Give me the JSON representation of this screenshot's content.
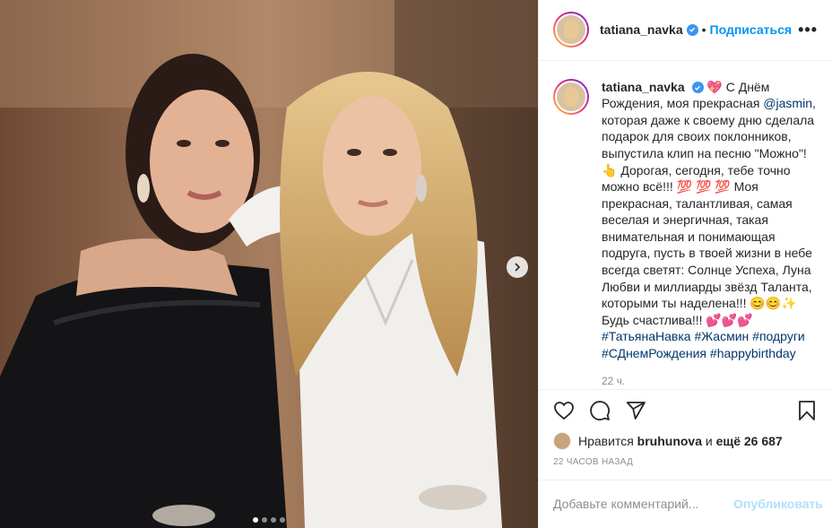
{
  "header": {
    "username": "tatiana_navka",
    "separator": "•",
    "follow_label": "Подписаться",
    "more_label": "•••"
  },
  "caption": {
    "username": "tatiana_navka",
    "emoji_heart": "💖",
    "t1": "С Днём Рождения, моя прекрасная ",
    "mention": "@jasmin",
    "t2": ", которая даже к своему дню сделала подарок для своих поклонников, выпустила клип на песню \"Можно\"! ",
    "emoji_point": "👆",
    "t3": " Дорогая, сегодня, тебе точно можно всё!!! ",
    "emoji_100": "💯 💯 💯",
    "t4": " Моя прекрасная, талантливая, самая веселая и энергичная, такая внимательная и понимающая подруга, пусть в твоей жизни в небе всегда светят: Солнце Успеха, Луна Любви и миллиарды звёзд Таланта, которыми ты наделена!!! ",
    "emoji_smiles": "😊😊✨",
    "t5": " Будь счастлива!!! ",
    "emoji_hearts": "💕💕💕",
    "tags": [
      "#ТатьянаНавка",
      "#Жасмин",
      "#подруги",
      "#СДнемРождения",
      "#happybirthday"
    ],
    "time": "22 ч."
  },
  "likes": {
    "prefix": "Нравится ",
    "user": "bruhunova",
    "middle": " и ",
    "count": "ещё 26 687"
  },
  "posted_ago": "22 ЧАСОВ НАЗАД",
  "comment": {
    "placeholder": "Добавьте комментарий...",
    "publish_label": "Опубликовать"
  },
  "carousel": {
    "current": 1,
    "total": 4
  },
  "icons": [
    "heart-icon",
    "comment-icon",
    "share-icon",
    "bookmark-icon",
    "chevron-right-icon",
    "verified-icon"
  ]
}
